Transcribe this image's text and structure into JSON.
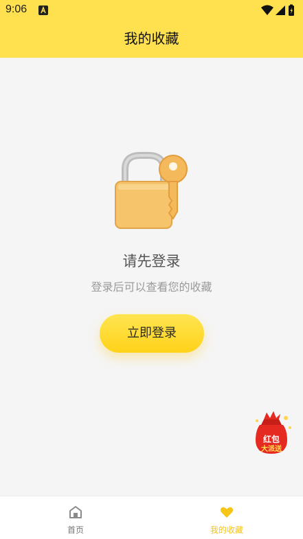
{
  "status_bar": {
    "time": "9:06",
    "notification_icon": "app-notification-icon",
    "wifi_icon": "wifi-icon",
    "signal_icon": "signal-icon",
    "battery_icon": "battery-icon"
  },
  "header": {
    "title": "我的收藏"
  },
  "empty_state": {
    "illustration_icon": "lock-key-icon",
    "title": "请先登录",
    "subtitle": "登录后可以查看您的收藏",
    "button_label": "立即登录"
  },
  "promo": {
    "icon": "red-envelope-promo-icon",
    "text": "红包大派送"
  },
  "bottom_nav": {
    "tabs": [
      {
        "label": "首页",
        "icon": "home-icon",
        "active": false
      },
      {
        "label": "我的收藏",
        "icon": "heart-icon",
        "active": true
      }
    ]
  },
  "colors": {
    "header_bg": "#ffe14f",
    "accent": "#f5c518",
    "page_bg": "#f5f5f5",
    "promo_red": "#e52a22"
  }
}
